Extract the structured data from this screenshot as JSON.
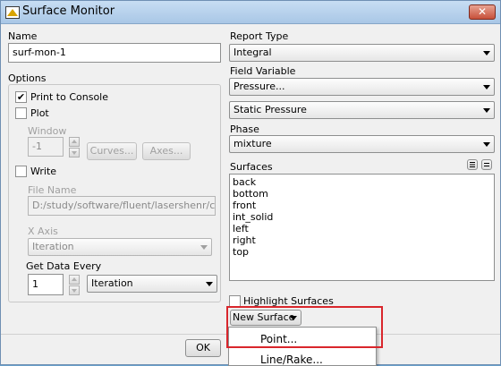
{
  "window": {
    "title": "Surface Monitor",
    "close_label": "✕"
  },
  "name": {
    "label": "Name",
    "value": "surf-mon-1"
  },
  "options": {
    "label": "Options",
    "print_to_console": {
      "label": "Print to Console",
      "checked": true
    },
    "plot": {
      "label": "Plot",
      "checked": false
    },
    "window_label": "Window",
    "window_value": "-1",
    "curves_label": "Curves...",
    "axes_label": "Axes...",
    "write": {
      "label": "Write",
      "checked": false
    },
    "file_name_label": "File Name",
    "file_name_value": "D:/study/software/fluent/lasershenr/chang",
    "x_axis_label": "X Axis",
    "x_axis_value": "Iteration",
    "get_data_every_label": "Get Data Every",
    "get_data_every_value": "1",
    "get_data_unit": "Iteration"
  },
  "report_type": {
    "label": "Report Type",
    "value": "Integral"
  },
  "field_variable": {
    "label": "Field Variable",
    "value": "Pressure...",
    "sub_value": "Static Pressure"
  },
  "phase": {
    "label": "Phase",
    "value": "mixture"
  },
  "surfaces": {
    "label": "Surfaces",
    "items": [
      "back",
      "bottom",
      "front",
      "int_solid",
      "left",
      "right",
      "top"
    ]
  },
  "highlight_surfaces": {
    "label": "Highlight Surfaces",
    "checked": false
  },
  "new_surface": {
    "label": "New Surface",
    "menu": [
      "Point...",
      "Line/Rake..."
    ]
  },
  "ok_label": "OK",
  "colors": {
    "highlight_box": "#d9262c",
    "title_gradient_top": "#c7ddf3"
  }
}
